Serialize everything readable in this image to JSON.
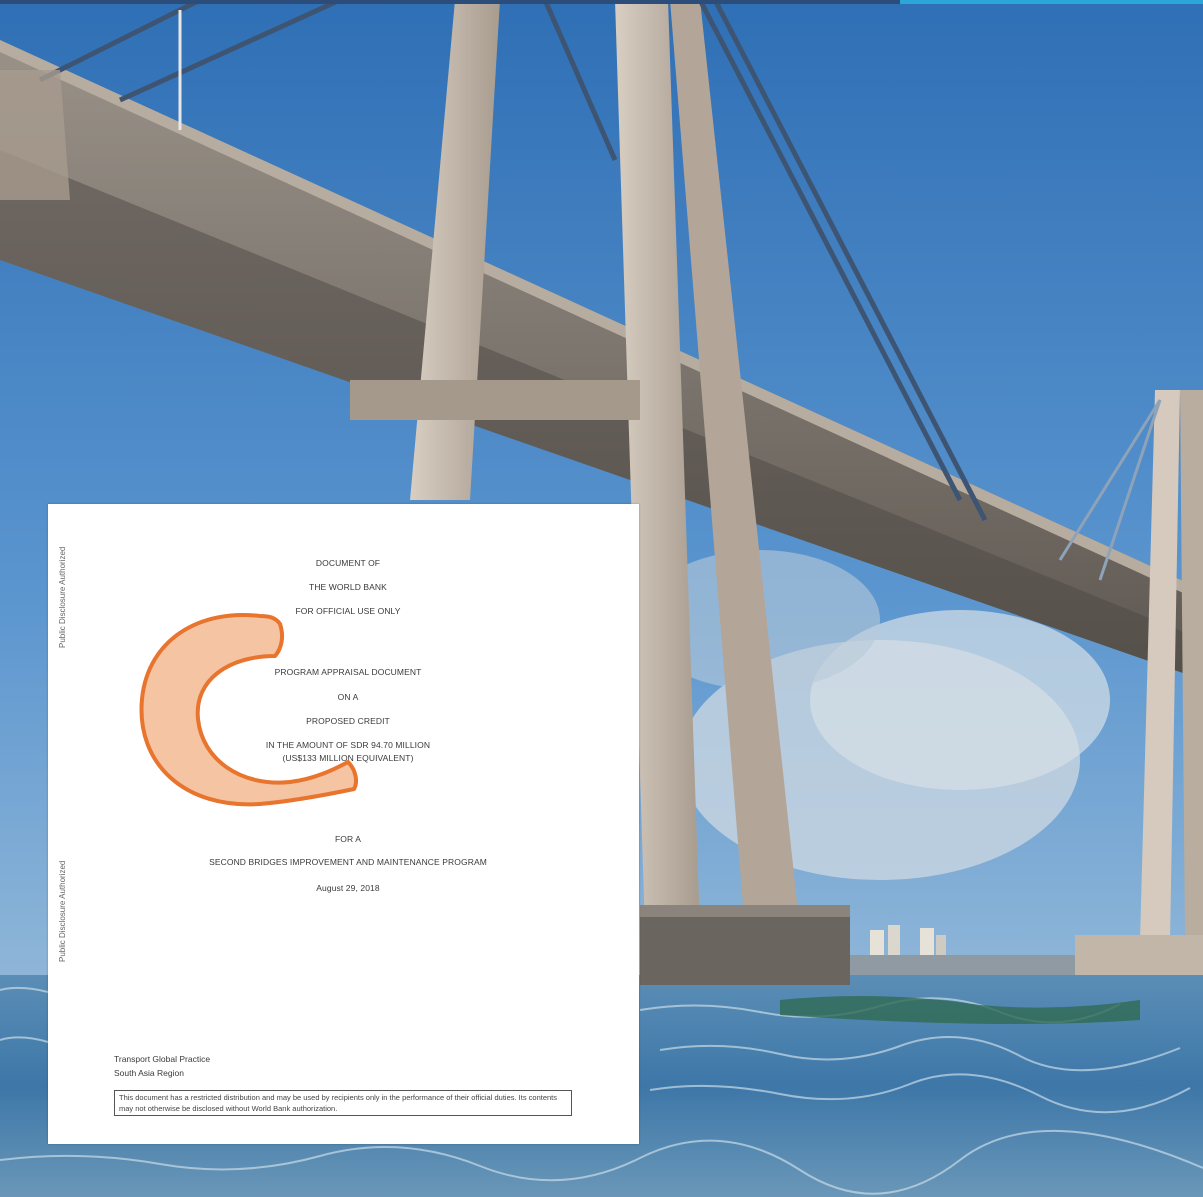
{
  "document": {
    "side_label_top": "Public Disclosure Authorized",
    "side_label_bottom": "Public Disclosure Authorized",
    "header": [
      "DOCUMENT OF",
      "THE WORLD BANK",
      "FOR OFFICIAL USE ONLY"
    ],
    "title_lines": [
      "PROGRAM APPRAISAL DOCUMENT",
      "ON A",
      "PROPOSED CREDIT",
      "IN THE AMOUNT OF SDR 94.70 MILLION",
      "(US$133 MILLION EQUIVALENT)"
    ],
    "for_a": "FOR A",
    "program_name": "SECOND BRIDGES IMPROVEMENT AND MAINTENANCE PROGRAM",
    "date": "August 29, 2018",
    "practice": "Transport Global Practice",
    "region": "South Asia Region",
    "notice_text": "This document has a restricted distribution and may be used by recipients only in the performance of their official duties. Its contents may not otherwise be disclosed without World Bank authorization."
  },
  "colors": {
    "sky": "#3f7fc2",
    "concrete": "#c9bfb3",
    "water": "#4a86b6",
    "logo_fill": "#f5c4a3",
    "logo_stroke": "#e8742e"
  },
  "icons": {
    "logo": "c-shape-logo"
  }
}
